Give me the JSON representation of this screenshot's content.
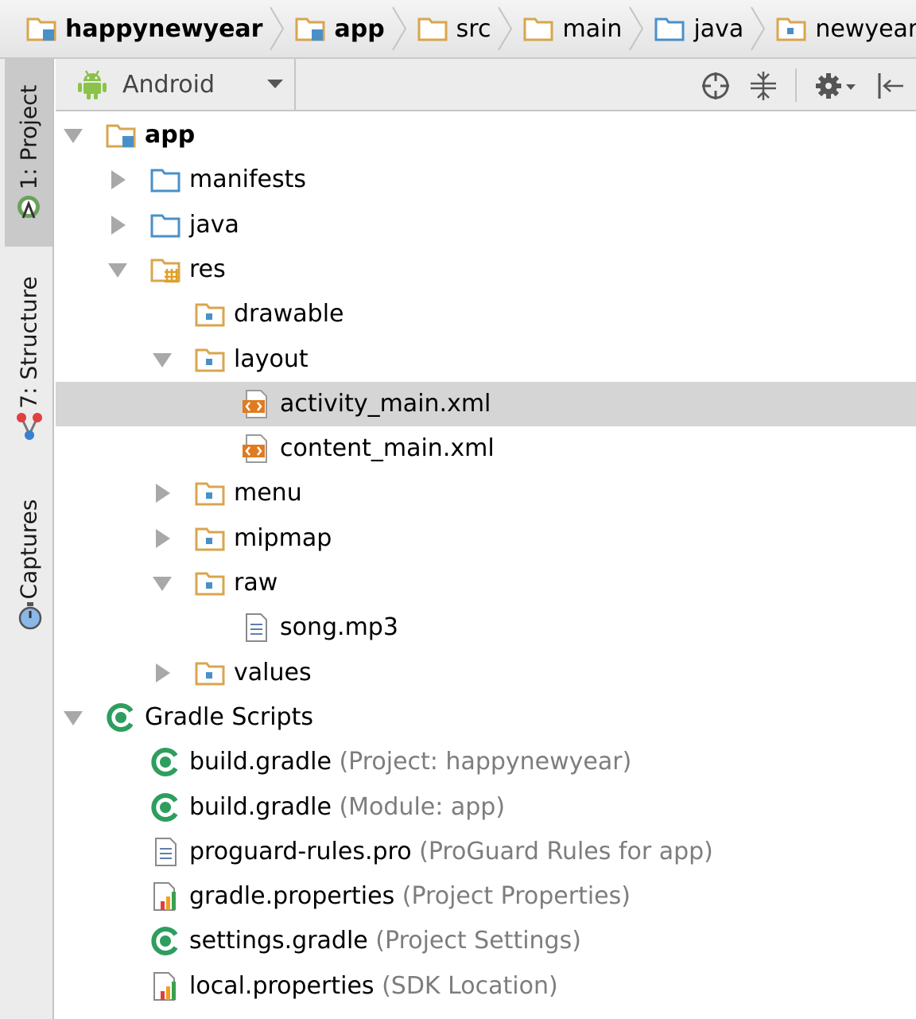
{
  "breadcrumb": [
    {
      "label": "happynewyear",
      "icon": "module-folder-icon",
      "bold": true
    },
    {
      "label": "app",
      "icon": "module-folder-icon",
      "bold": true
    },
    {
      "label": "src",
      "icon": "folder-icon",
      "bold": false
    },
    {
      "label": "main",
      "icon": "folder-icon",
      "bold": false
    },
    {
      "label": "java",
      "icon": "source-folder-icon",
      "bold": false
    },
    {
      "label": "newyear",
      "icon": "package-icon",
      "bold": false
    }
  ],
  "tool_strip": {
    "project_tab": "1: Project",
    "structure_tab": "7: Structure",
    "captures_tab": "Captures"
  },
  "toolbar": {
    "view_mode": "Android"
  },
  "tree": [
    {
      "label": "app",
      "hint": "",
      "icon": "module-folder-icon",
      "arrow": "expanded",
      "bold": true,
      "level": 0
    },
    {
      "label": "manifests",
      "hint": "",
      "icon": "source-folder-icon",
      "arrow": "collapsed",
      "bold": false,
      "level": 1
    },
    {
      "label": "java",
      "hint": "",
      "icon": "source-folder-icon",
      "arrow": "collapsed",
      "bold": false,
      "level": 1
    },
    {
      "label": "res",
      "hint": "",
      "icon": "resource-folder-icon",
      "arrow": "expanded",
      "bold": false,
      "level": 1
    },
    {
      "label": "drawable",
      "hint": "",
      "icon": "package-icon",
      "arrow": "none",
      "bold": false,
      "level": 2
    },
    {
      "label": "layout",
      "hint": "",
      "icon": "package-icon",
      "arrow": "expanded",
      "bold": false,
      "level": 2
    },
    {
      "label": "activity_main.xml",
      "hint": "",
      "icon": "xml-file-icon",
      "arrow": "none",
      "bold": false,
      "level": 3,
      "selected": true
    },
    {
      "label": "content_main.xml",
      "hint": "",
      "icon": "xml-file-icon",
      "arrow": "none",
      "bold": false,
      "level": 3
    },
    {
      "label": "menu",
      "hint": "",
      "icon": "package-icon",
      "arrow": "collapsed",
      "bold": false,
      "level": 2
    },
    {
      "label": "mipmap",
      "hint": "",
      "icon": "package-icon",
      "arrow": "collapsed",
      "bold": false,
      "level": 2
    },
    {
      "label": "raw",
      "hint": "",
      "icon": "package-icon",
      "arrow": "expanded",
      "bold": false,
      "level": 2
    },
    {
      "label": "song.mp3",
      "hint": "",
      "icon": "text-file-icon",
      "arrow": "none",
      "bold": false,
      "level": 3
    },
    {
      "label": "values",
      "hint": "",
      "icon": "package-icon",
      "arrow": "collapsed",
      "bold": false,
      "level": 2
    },
    {
      "label": "Gradle Scripts",
      "hint": "",
      "icon": "gradle-icon",
      "arrow": "expanded",
      "bold": false,
      "level": 0
    },
    {
      "label": "build.gradle",
      "hint": " (Project: happynewyear)",
      "icon": "gradle-icon",
      "arrow": "none",
      "bold": false,
      "level": 1
    },
    {
      "label": "build.gradle",
      "hint": " (Module: app)",
      "icon": "gradle-icon",
      "arrow": "none",
      "bold": false,
      "level": 1
    },
    {
      "label": "proguard-rules.pro",
      "hint": " (ProGuard Rules for app)",
      "icon": "text-file-icon",
      "arrow": "none",
      "bold": false,
      "level": 1
    },
    {
      "label": "gradle.properties",
      "hint": " (Project Properties)",
      "icon": "properties-file-icon",
      "arrow": "none",
      "bold": false,
      "level": 1
    },
    {
      "label": "settings.gradle",
      "hint": " (Project Settings)",
      "icon": "gradle-icon",
      "arrow": "none",
      "bold": false,
      "level": 1
    },
    {
      "label": "local.properties",
      "hint": " (SDK Location)",
      "icon": "properties-file-icon",
      "arrow": "none",
      "bold": false,
      "level": 1
    }
  ],
  "colors": {
    "folder": "#d9a54e",
    "source_folder": "#4a90c8",
    "gradle": "#2e9e5e",
    "xml": "#e07b1f",
    "android": "#8bc34a"
  }
}
